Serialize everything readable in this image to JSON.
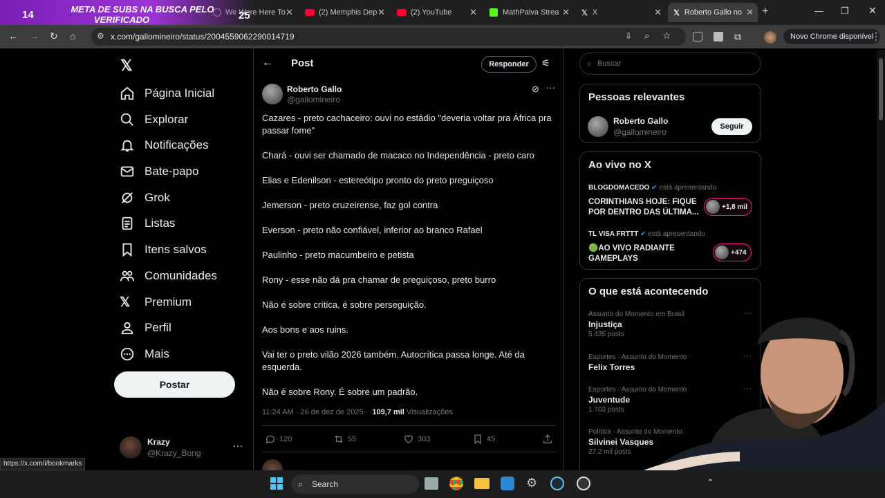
{
  "browser": {
    "tabs": [
      {
        "label": "We Were Here To",
        "icon": "globe-icon"
      },
      {
        "label": "(2) Memphis Dep",
        "icon": "youtube-icon"
      },
      {
        "label": "(2) YouTube",
        "icon": "youtube-icon"
      },
      {
        "label": "MathPaiva Strea",
        "icon": "kick-icon"
      },
      {
        "label": "X",
        "icon": "x-logo-icon"
      },
      {
        "label": "Roberto Gallo no",
        "icon": "x-logo-icon",
        "active": true
      }
    ],
    "url": "x.com/gallomineiro/status/2004559062290014719",
    "update_label": "Novo Chrome disponível",
    "status_url": "https://x.com/i/bookmarks"
  },
  "overlay": {
    "count_left": "14",
    "count_right": "25",
    "banner_line1": "META DE SUBS NA BUSCA PELO",
    "banner_line2": "VERIFICADO"
  },
  "sidebar": {
    "items": [
      {
        "label": "Página Inicial",
        "icon": "home-icon"
      },
      {
        "label": "Explorar",
        "icon": "search-icon"
      },
      {
        "label": "Notificações",
        "icon": "bell-icon"
      },
      {
        "label": "Bate-papo",
        "icon": "mail-icon"
      },
      {
        "label": "Grok",
        "icon": "grok-icon"
      },
      {
        "label": "Listas",
        "icon": "list-icon"
      },
      {
        "label": "Itens salvos",
        "icon": "bookmark-icon"
      },
      {
        "label": "Comunidades",
        "icon": "people-icon"
      },
      {
        "label": "Premium",
        "icon": "x-logo-icon"
      },
      {
        "label": "Perfil",
        "icon": "person-icon"
      },
      {
        "label": "Mais",
        "icon": "more-icon"
      }
    ],
    "post_button": "Postar",
    "account": {
      "name": "Krazy",
      "handle": "@Krazy_Bong"
    }
  },
  "header": {
    "title": "Post",
    "reply_button": "Responder"
  },
  "tweet": {
    "author": "Roberto Gallo",
    "handle": "@gallomineiro",
    "lines": [
      "Cazares - preto cachaceiro: ouvi no estádio \"deveria voltar pra África pra passar fome\"",
      "Chará - ouvi ser chamado de macaco no Independência - preto caro",
      "Elias e Edenilson - estereótipo pronto do preto preguiçoso",
      "Jemerson - preto cruzeirense, faz gol contra",
      "Everson - preto não confiável, inferior ao branco Rafael",
      "Paulinho - preto macumbeiro e petista",
      "Rony - esse não dá pra chamar de preguiçoso, preto burro",
      "Não é sobre crítica, é sobre perseguição.",
      "Aos bons e aos ruins.",
      "Vai ter o preto vilão 2026 também. Autocrítica passa longe. Até da esquerda.",
      "Não é sobre Rony. É sobre um padrão."
    ],
    "timestamp": "11:24 AM · 26 de dez de 2025 ·",
    "views": "109,7 mil",
    "views_label": "Visualizações",
    "replies": "120",
    "reposts": "55",
    "likes": "303",
    "bookmarks": "45"
  },
  "search": {
    "placeholder": "Buscar"
  },
  "relevant": {
    "title": "Pessoas relevantes",
    "name": "Roberto Gallo",
    "handle": "@gallomineiro",
    "follow_button": "Seguir"
  },
  "live": {
    "title": "Ao vivo no X",
    "items": [
      {
        "host": "BLOGDOMACEDO",
        "status": "está apresentando",
        "text_line1": "CORINTHIANS HOJE: FIQUE",
        "text_line2": "POR DENTRO DAS ÚLTIMA...",
        "count": "+1,8 mil"
      },
      {
        "host": "TL VISA FRTTT",
        "status": "está apresentando",
        "text_line1": "🟢AO VIVO RADIANTE",
        "text_line2": "GAMEPLAYS",
        "count": "+474"
      }
    ]
  },
  "trends": {
    "title": "O que está acontecendo",
    "items": [
      {
        "context": "Assunto do Momento em Brasil",
        "name": "Injustiça",
        "posts": "5.435 posts"
      },
      {
        "context": "Esportes · Assunto do Momento",
        "name": "Felix Torres",
        "posts": ""
      },
      {
        "context": "Esportes · Assunto do Momento",
        "name": "Juventude",
        "posts": "1.703 posts"
      },
      {
        "context": "Política · Assunto do Momento",
        "name": "Silvinei Vasques",
        "posts": "27,2 mil posts"
      }
    ]
  },
  "taskbar": {
    "search_placeholder": "Search"
  },
  "colors": {
    "accent": "#1d9bf0",
    "live_pink": "#f91880",
    "verified": "#1d9bf0",
    "banner": "#9b33d6"
  }
}
